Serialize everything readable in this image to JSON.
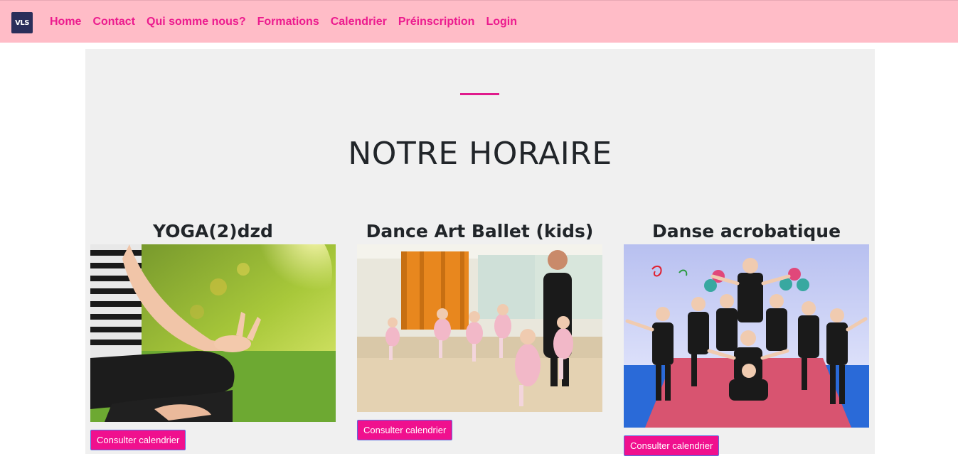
{
  "navbar": {
    "logo_text": "VLS",
    "links": [
      {
        "label": "Home"
      },
      {
        "label": "Contact"
      },
      {
        "label": "Qui somme nous?"
      },
      {
        "label": "Formations"
      },
      {
        "label": "Calendrier"
      },
      {
        "label": "Préinscription"
      },
      {
        "label": "Login"
      }
    ]
  },
  "main": {
    "title": "NOTRE HORAIRE",
    "cards": [
      {
        "title": "YOGA(2)dzd",
        "image": "yoga-meditation-photo",
        "button_label": "Consulter calendrier"
      },
      {
        "title": "Dance Art Ballet (kids)",
        "image": "kids-ballet-class-photo",
        "button_label": "Consulter calendrier"
      },
      {
        "title": "Danse acrobatique",
        "image": "acrobatic-dance-group-photo",
        "button_label": "Consulter calendrier"
      }
    ]
  },
  "colors": {
    "navbar_bg": "#ffbcc7",
    "accent": "#ec1b8e",
    "button_bg": "#f0108e",
    "section_bg": "#f0f0f0"
  }
}
